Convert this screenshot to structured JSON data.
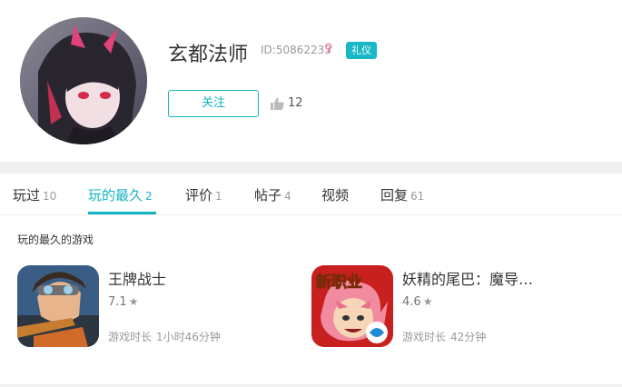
{
  "profile": {
    "username": "玄都法师",
    "user_id": "ID:50862233",
    "gender_icon": "female-symbol-icon",
    "badge": "礼仪",
    "follow_label": "关注",
    "like_count": "12",
    "colors": {
      "accent": "#14b4c4",
      "gender": "#f06aa0"
    }
  },
  "tabs": [
    {
      "label": "玩过",
      "count": "10"
    },
    {
      "label": "玩的最久",
      "count": "2",
      "active": true
    },
    {
      "label": "评价",
      "count": "1"
    },
    {
      "label": "帖子",
      "count": "4"
    },
    {
      "label": "视频",
      "count": ""
    },
    {
      "label": "回复",
      "count": "61"
    }
  ],
  "section": {
    "title": "玩的最久的游戏"
  },
  "games": [
    {
      "name": "王牌战士",
      "rating": "7.1",
      "time_label": "游戏时长",
      "time_value": "1小时46分钟",
      "icon": "soldier-goggles-icon"
    },
    {
      "name": "妖精的尾巴：魔导…",
      "rating": "4.6",
      "time_label": "游戏时长",
      "time_value": "42分钟",
      "icon_text": "新职业",
      "icon": "fairy-tail-natsu-icon"
    }
  ]
}
